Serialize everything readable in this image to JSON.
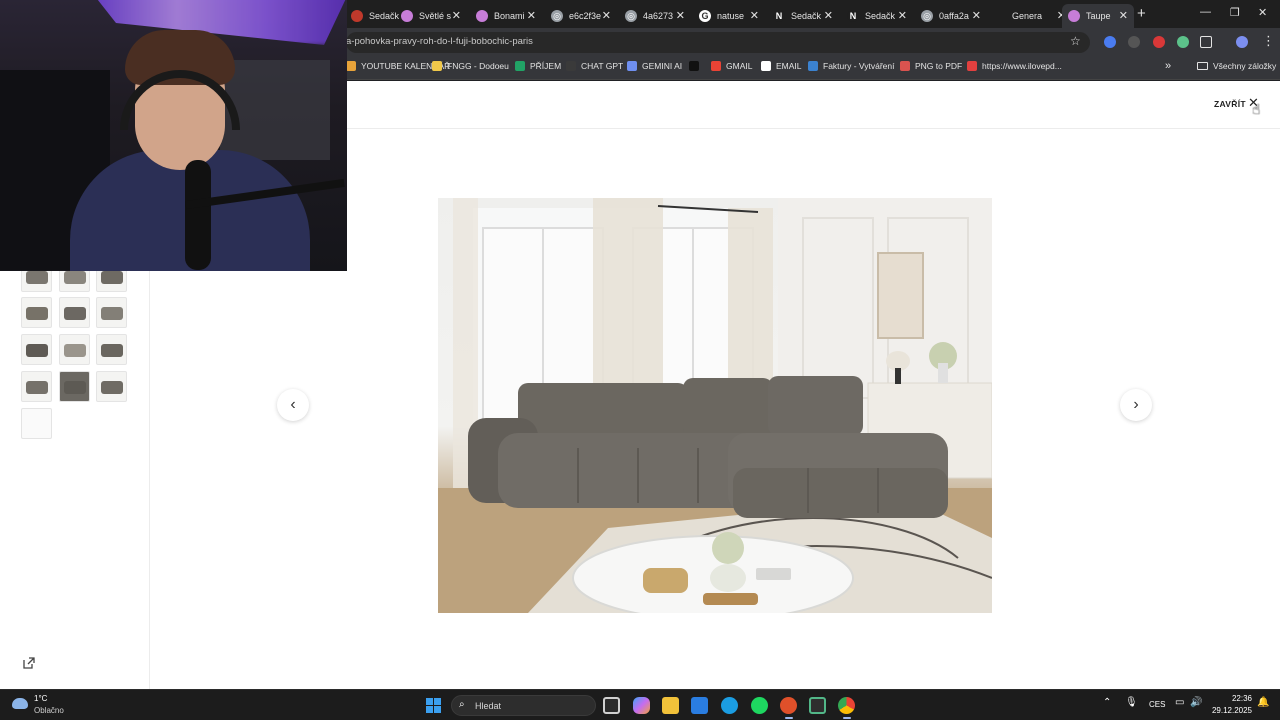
{
  "browser": {
    "tabs": [
      {
        "label": "Sedačk",
        "icon": "sofa-site"
      },
      {
        "label": "Světlé s",
        "icon": "bonami"
      },
      {
        "label": "Bonami",
        "icon": "bonami"
      },
      {
        "label": "e6c2f3e",
        "icon": "chatgpt"
      },
      {
        "label": "4a6273",
        "icon": "chatgpt"
      },
      {
        "label": "natuse",
        "icon": "google"
      },
      {
        "label": "Sedačk",
        "icon": "n-site"
      },
      {
        "label": "Sedačk",
        "icon": "n-site"
      },
      {
        "label": "0affa2a",
        "icon": "chatgpt"
      },
      {
        "label": "Genera",
        "icon": "blank"
      },
      {
        "label": "Taupe",
        "icon": "bonami"
      }
    ],
    "url": "a-pohovka-pravy-roh-do-l-fuji-bobochic-paris",
    "bookmarks": [
      {
        "label": "YOUTUBE KALENDÁŘ",
        "color": "#e8a33a"
      },
      {
        "label": "FNGG - Dodoeu",
        "color": "#f0c84a"
      },
      {
        "label": "PŘÍJEM",
        "color": "#21a366"
      },
      {
        "label": "CHAT GPT",
        "color": "#3a3a3a"
      },
      {
        "label": "GEMINI AI",
        "color": "#6f8ff0"
      },
      {
        "label": "",
        "color": "#111111"
      },
      {
        "label": "GMAIL",
        "color": "#ea4335"
      },
      {
        "label": "EMAIL",
        "color": "#ffffff"
      },
      {
        "label": "Faktury - Vytváření",
        "color": "#3b82d0"
      },
      {
        "label": "PNG to PDF",
        "color": "#d9534f"
      },
      {
        "label": "https://www.ilovepd...",
        "color": "#e2403f"
      }
    ],
    "bookmarks_more": "»",
    "all_bookmarks": "Všechny záložky"
  },
  "page": {
    "close_label": "ZAVŘÍT",
    "close_icon": "close-icon",
    "prev_arrow": "‹",
    "next_arrow": "›"
  },
  "taskbar": {
    "weather_temp": "1°C",
    "weather_desc": "Oblačno",
    "search_placeholder": "Hledat",
    "language": "CES",
    "time": "22:36",
    "date": "29.12.2025"
  }
}
